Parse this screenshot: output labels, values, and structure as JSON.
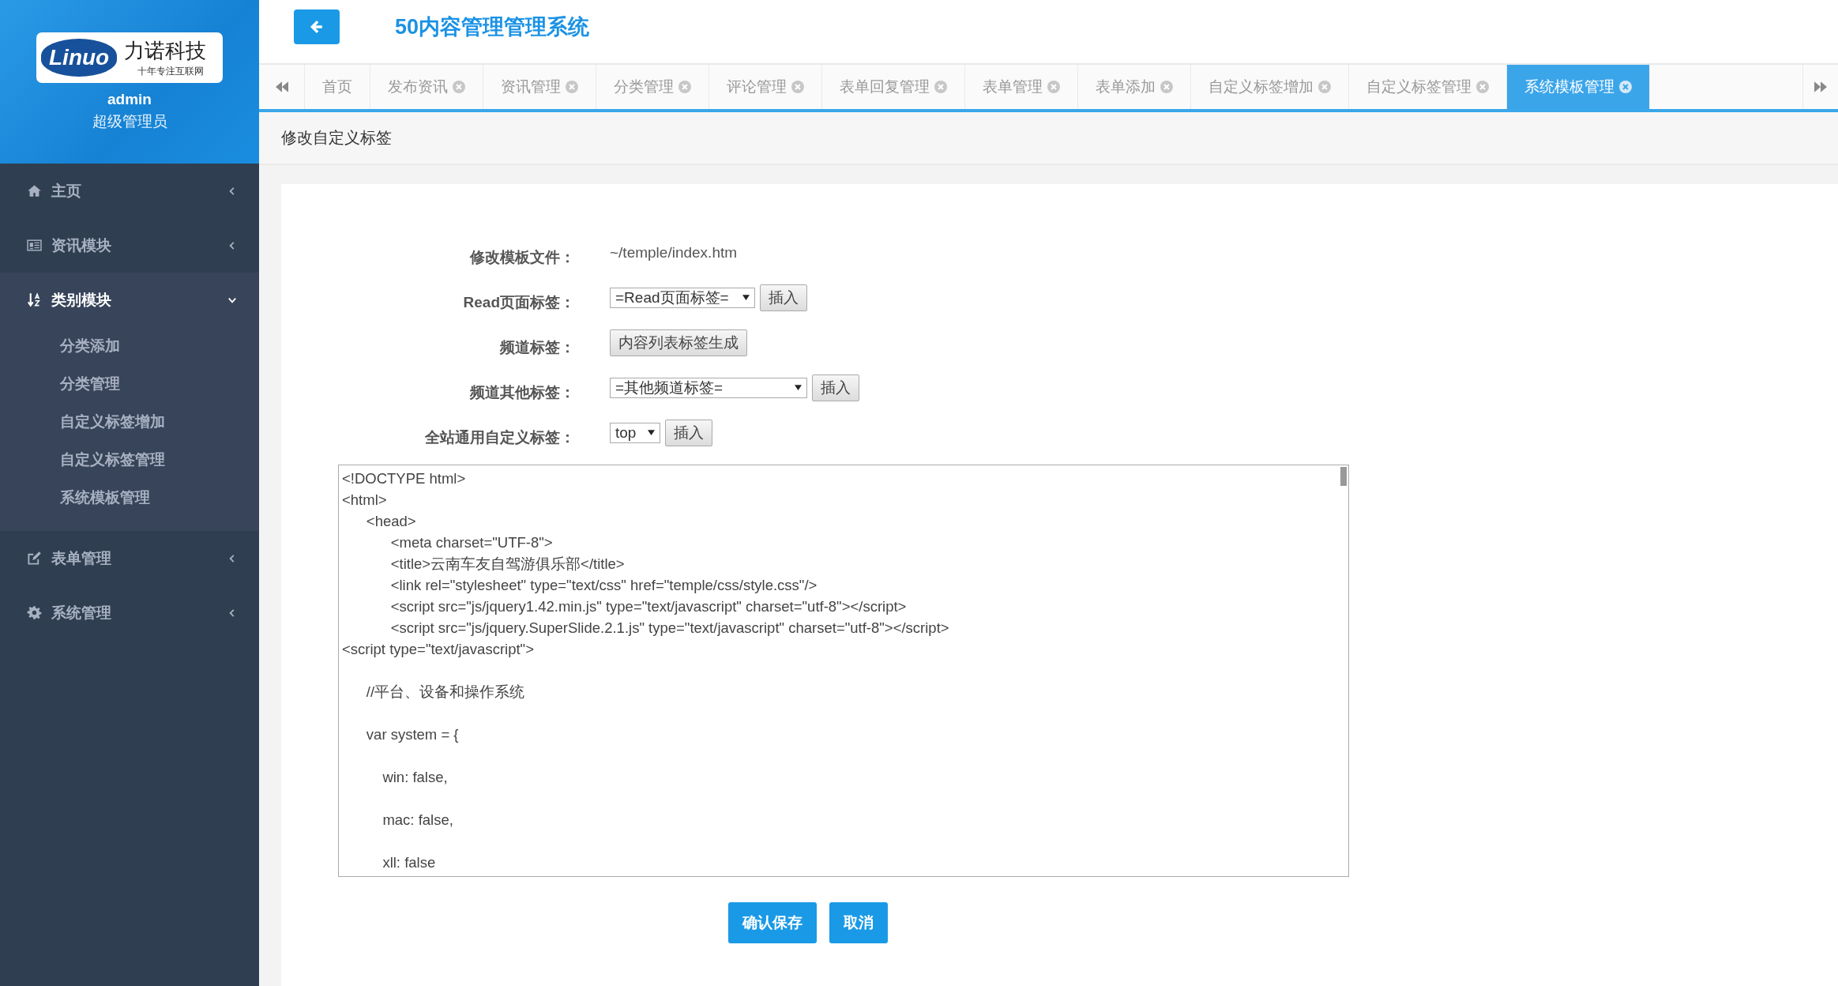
{
  "sidebar": {
    "user": {
      "name": "admin",
      "role": "超级管理员"
    },
    "logo": {
      "brand": "Linuo",
      "company": "力诺科技",
      "slogan": "十年专注互联网"
    },
    "items": [
      {
        "label": "主页",
        "expanded": false
      },
      {
        "label": "资讯模块",
        "expanded": false
      },
      {
        "label": "类别模块",
        "expanded": true,
        "children": [
          {
            "label": "分类添加"
          },
          {
            "label": "分类管理"
          },
          {
            "label": "自定义标签增加"
          },
          {
            "label": "自定义标签管理"
          },
          {
            "label": "系统模板管理"
          }
        ]
      },
      {
        "label": "表单管理",
        "expanded": false
      },
      {
        "label": "系统管理",
        "expanded": false
      }
    ]
  },
  "header": {
    "title": "50内容管理管理系统"
  },
  "tabs": [
    {
      "label": "首页",
      "closable": false,
      "selected": false
    },
    {
      "label": "发布资讯",
      "closable": true,
      "selected": false
    },
    {
      "label": "资讯管理",
      "closable": true,
      "selected": false
    },
    {
      "label": "分类管理",
      "closable": true,
      "selected": false
    },
    {
      "label": "评论管理",
      "closable": true,
      "selected": false
    },
    {
      "label": "表单回复管理",
      "closable": true,
      "selected": false
    },
    {
      "label": "表单管理",
      "closable": true,
      "selected": false
    },
    {
      "label": "表单添加",
      "closable": true,
      "selected": false
    },
    {
      "label": "自定义标签增加",
      "closable": true,
      "selected": false
    },
    {
      "label": "自定义标签管理",
      "closable": true,
      "selected": false
    },
    {
      "label": "系统模板管理",
      "closable": true,
      "selected": true
    }
  ],
  "breadcrumb": "修改自定义标签",
  "form": {
    "rows": [
      {
        "kind": "text",
        "label": "修改模板文件：",
        "value": "~/temple/index.htm"
      },
      {
        "kind": "select",
        "label": "Read页面标签：",
        "value": "=Read页面标签=",
        "button": "插入"
      },
      {
        "kind": "button",
        "label": "频道标签：",
        "button": "内容列表标签生成"
      },
      {
        "kind": "select",
        "label": "频道其他标签：",
        "value": "=其他频道标签=",
        "button": "插入"
      },
      {
        "kind": "select",
        "label": "全站通用自定义标签：",
        "value": "top",
        "button": "插入"
      }
    ],
    "code": "<!DOCTYPE html>\n<html>\n\t<head>\n\t\t<meta charset=\"UTF-8\">\n\t\t<title>云南车友自驾游俱乐部</title>\n\t\t<link rel=\"stylesheet\" type=\"text/css\" href=\"temple/css/style.css\"/>\n\t\t<script src=\"js/jquery1.42.min.js\" type=\"text/javascript\" charset=\"utf-8\"></script>\n\t\t<script src=\"js/jquery.SuperSlide.2.1.js\" type=\"text/javascript\" charset=\"utf-8\"></script>\n<script type=\"text/javascript\">\n\n\t//平台、设备和操作系统\n\n\tvar system = {\n\n\t    win: false,\n\n\t    mac: false,\n\n\t    xll: false",
    "buttons": [
      {
        "kind": "primary",
        "label": "确认保存"
      },
      {
        "kind": "primary",
        "label": "取消"
      }
    ]
  }
}
